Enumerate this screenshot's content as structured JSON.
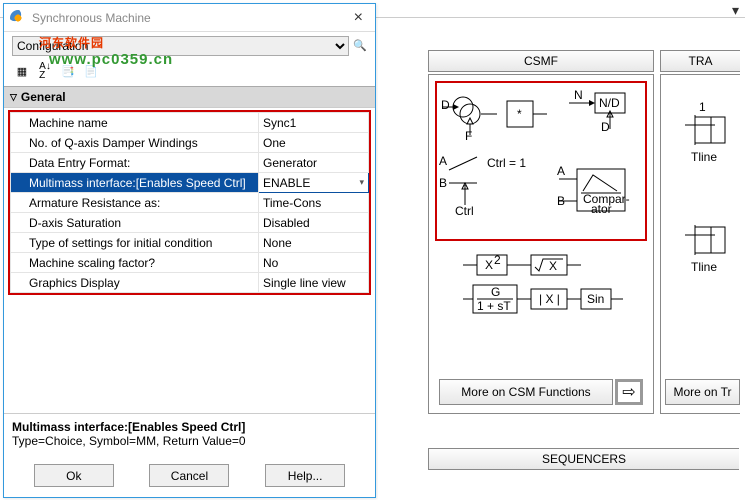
{
  "toolbar": {
    "menu_glyph": "▾"
  },
  "dialog": {
    "title": "Synchronous Machine",
    "config_label": "Configuration",
    "watermark_text": "河东软件园",
    "watermark_url": "www.pc0359.cn",
    "general_header": "General",
    "properties": [
      {
        "name": "Machine name",
        "value": "Sync1"
      },
      {
        "name": "No. of Q-axis Damper Windings",
        "value": "One"
      },
      {
        "name": "Data Entry Format:",
        "value": "Generator"
      },
      {
        "name": "Multimass interface:[Enables Speed Ctrl]",
        "value": "ENABLE",
        "selected": true
      },
      {
        "name": "Armature Resistance as:",
        "value": "Time-Cons"
      },
      {
        "name": "D-axis Saturation",
        "value": "Disabled"
      },
      {
        "name": "Type of settings for initial condition",
        "value": "None"
      },
      {
        "name": "Machine scaling factor?",
        "value": "No"
      },
      {
        "name": "Graphics Display",
        "value": "Single line view"
      }
    ],
    "hint": {
      "title": "Multimass interface:[Enables Speed Ctrl]",
      "desc": "Type=Choice, Symbol=MM, Return Value=0"
    },
    "buttons": {
      "ok": "Ok",
      "cancel": "Cancel",
      "help": "Help..."
    }
  },
  "palette": {
    "csmf": "CSMF",
    "tra": "TRA",
    "tline1": "Tline",
    "tline2": "Tline",
    "more_csm": "More on CSM Functions",
    "more_tr": "More on Tr",
    "seq": "SEQUENCERS",
    "labels": {
      "D": "D",
      "F": "F",
      "N": "N",
      "B": "B",
      "ND": "N/D",
      "comp1": "Compar-",
      "comp2": "ator",
      "ctrl_eq": "Ctrl  =  1",
      "ctrl": "Ctrl",
      "A": "A",
      "x2a": "X",
      "x2b": "2",
      "root": "X",
      "G": "G",
      "den": "1 + sT",
      "abs": "| X |",
      "sin": "Sin",
      "one": "1"
    }
  }
}
